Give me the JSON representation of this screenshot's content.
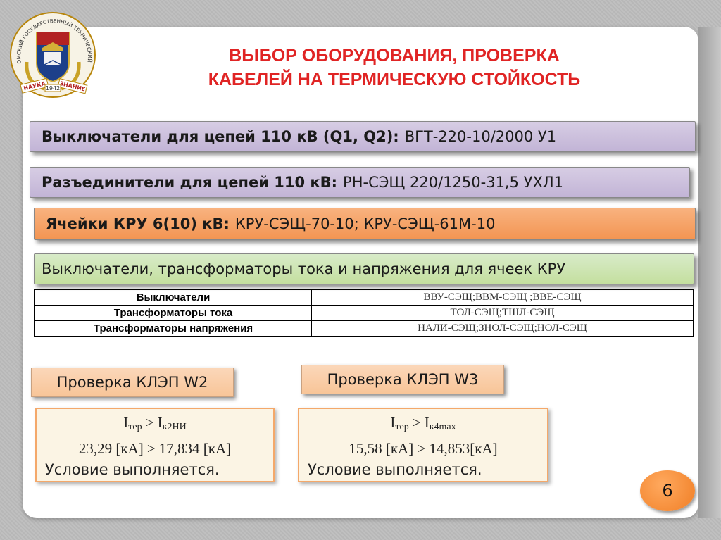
{
  "emblem": {
    "ring_text": "ОМСКИЙ ГОСУДАРСТВЕННЫЙ ТЕХНИЧЕСКИЙ УНИВЕРСИТЕТ",
    "banner_left": "НАУКА",
    "banner_right": "ЗНАНИЕ",
    "year": "1942"
  },
  "title": {
    "line1": "ВЫБОР ОБОРУДОВАНИЯ, ПРОВЕРКА",
    "line2": "КАБЕЛЕЙ НА ТЕРМИЧЕСКУЮ СТОЙКОСТЬ"
  },
  "bars": [
    {
      "label": "Выключатели для цепей 110 кВ (Q1, Q2):",
      "value": "ВГТ-220-10/2000 У1"
    },
    {
      "label": "Разъединители для цепей 110 кВ:",
      "value": "РН-СЭЩ 220/1250-31,5 УХЛ1"
    },
    {
      "label": "Ячейки КРУ 6(10) кВ:",
      "value": "КРУ-СЭЩ-70-10; КРУ-СЭЩ-61М-10"
    },
    {
      "text": "Выключатели, трансформаторы тока и напряжения для ячеек КРУ"
    }
  ],
  "equipment_table": {
    "rows": [
      {
        "name": "Выключатели",
        "value": "ВВУ-СЭЩ;ВВМ-СЭЩ ;ВВЕ-СЭЩ"
      },
      {
        "name": "Трансформаторы тока",
        "value": "ТОЛ-СЭЩ;ТШЛ-СЭЩ"
      },
      {
        "name": "Трансформаторы напряжения",
        "value": "НАЛИ-СЭЩ;ЗНОЛ-СЭЩ;НОЛ-СЭЩ"
      }
    ]
  },
  "checks": [
    {
      "label": "Проверка КЛЭП W2",
      "formula_lhs": "I",
      "formula_lhs_sub": "тер",
      "operator": "≥",
      "formula_rhs": "I",
      "formula_rhs_sub": "к2НИ",
      "numeric": "23,29 [кА] ≥ 17,834 [кА]",
      "status": "Условие выполняется."
    },
    {
      "label": "Проверка КЛЭП W3",
      "formula_lhs": "I",
      "formula_lhs_sub": "тер",
      "operator": "≥",
      "formula_rhs": "I",
      "formula_rhs_sub": "к4max",
      "numeric": "15,58 [кА] > 14,853[кА]",
      "status": "Условие выполняется."
    }
  ],
  "page_number": "6",
  "colors": {
    "title": "#e02424",
    "bar_purple": "#c2b4d6",
    "bar_orange": "#f39552",
    "bar_green": "#c4df9f",
    "check_label": "#f8c598",
    "page_badge": "#f07e25"
  }
}
